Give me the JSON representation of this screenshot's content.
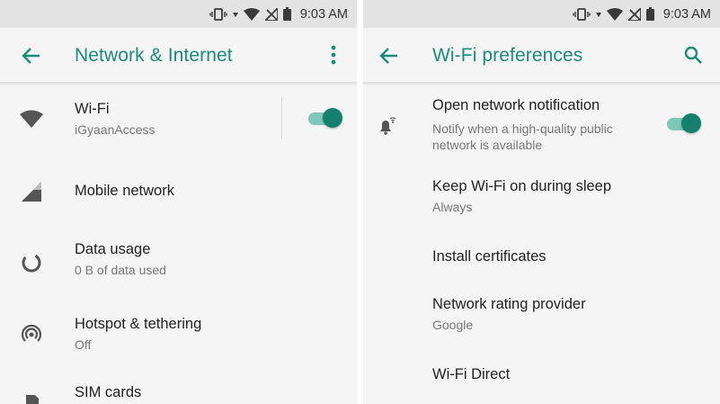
{
  "status_bar": {
    "time": "9:03 AM"
  },
  "left": {
    "title": "Network & Internet",
    "items": [
      {
        "label": "Wi-Fi",
        "sub": "iGyaanAccess",
        "icon": "wifi-icon",
        "toggle_on": true
      },
      {
        "label": "Mobile network",
        "icon": "cell-signal-icon"
      },
      {
        "label": "Data usage",
        "sub": "0 B of data used",
        "icon": "data-usage-icon"
      },
      {
        "label": "Hotspot & tethering",
        "sub": "Off",
        "icon": "hotspot-icon"
      },
      {
        "label": "SIM cards",
        "icon": "sim-card-icon"
      }
    ]
  },
  "right": {
    "title": "Wi-Fi preferences",
    "items": [
      {
        "label": "Open network notification",
        "sub_line1": "Notify when a high-quality public",
        "sub_line2": "network is available",
        "icon": "notification-wifi-icon",
        "toggle_on": true
      },
      {
        "label": "Keep Wi-Fi on during sleep",
        "sub": "Always"
      },
      {
        "label": "Install certificates"
      },
      {
        "label": "Network rating provider",
        "sub": "Google"
      },
      {
        "label": "Wi-Fi Direct"
      }
    ]
  },
  "colors": {
    "accent": "#1a8c7a",
    "toggle_thumb": "#16806f",
    "toggle_track": "#7fc7bb"
  }
}
